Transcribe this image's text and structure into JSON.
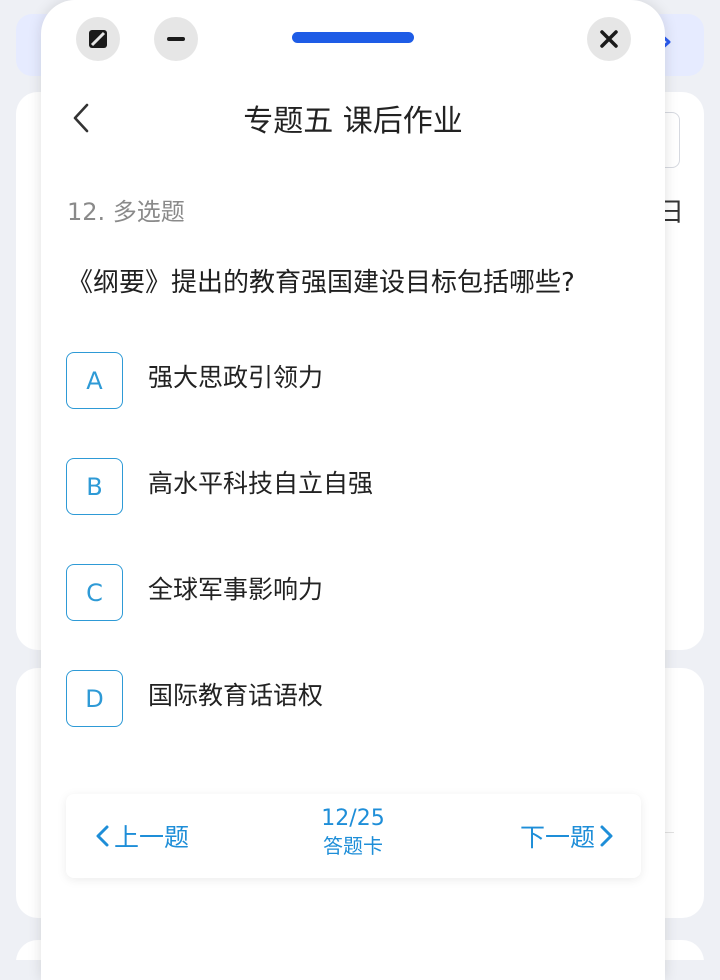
{
  "background": {
    "partial_char": "日"
  },
  "window_controls": {
    "resize_icon": "resize-icon",
    "minimize_icon": "minus-icon",
    "close_icon": "close-icon"
  },
  "header": {
    "title": "专题五 课后作业"
  },
  "question": {
    "type_label": "12. 多选题",
    "text": "《纲要》提出的教育强国建设目标包括哪些?",
    "options": [
      {
        "letter": "A",
        "text": "强大思政引领力"
      },
      {
        "letter": "B",
        "text": "高水平科技自立自强"
      },
      {
        "letter": "C",
        "text": "全球军事影响力"
      },
      {
        "letter": "D",
        "text": "国际教育话语权"
      }
    ]
  },
  "navigation": {
    "prev_label": "上一题",
    "next_label": "下一题",
    "progress": "12/25",
    "answer_card_label": "答题卡"
  },
  "colors": {
    "accent": "#1e5ce6",
    "option_blue": "#2e9ad6",
    "nav_blue": "#1e8ed8"
  }
}
